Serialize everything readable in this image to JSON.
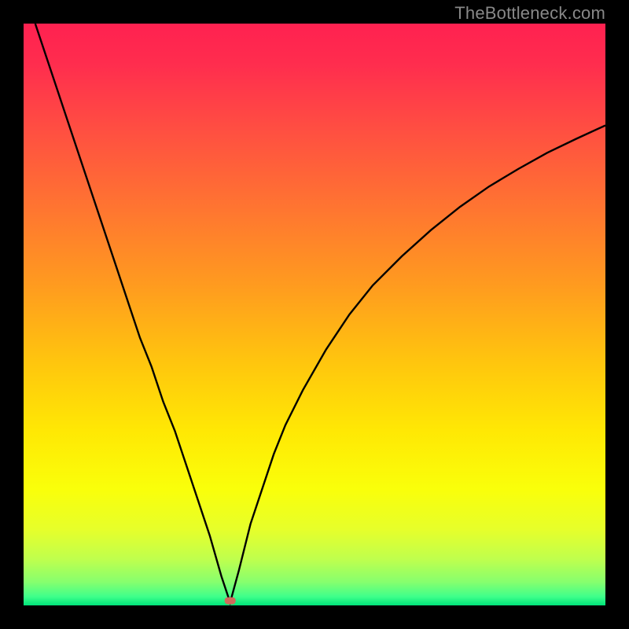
{
  "watermark": "TheBottleneck.com",
  "chart_data": {
    "type": "line",
    "title": "",
    "xlabel": "",
    "ylabel": "",
    "xlim": [
      0,
      100
    ],
    "ylim": [
      0,
      100
    ],
    "background": {
      "type": "vertical_gradient",
      "stops": [
        {
          "pos": 0.0,
          "color": "#ff2150"
        },
        {
          "pos": 0.07,
          "color": "#ff2d4e"
        },
        {
          "pos": 0.17,
          "color": "#ff4b43"
        },
        {
          "pos": 0.3,
          "color": "#ff7033"
        },
        {
          "pos": 0.45,
          "color": "#ff9b1f"
        },
        {
          "pos": 0.58,
          "color": "#ffc50e"
        },
        {
          "pos": 0.7,
          "color": "#ffe804"
        },
        {
          "pos": 0.8,
          "color": "#faff0a"
        },
        {
          "pos": 0.87,
          "color": "#e6ff2b"
        },
        {
          "pos": 0.92,
          "color": "#c0ff4d"
        },
        {
          "pos": 0.96,
          "color": "#86ff6e"
        },
        {
          "pos": 0.985,
          "color": "#3fff8b"
        },
        {
          "pos": 1.0,
          "color": "#00e47a"
        }
      ]
    },
    "marker": {
      "x": 35.5,
      "y": 0.8,
      "color": "#d06a5c"
    },
    "series": [
      {
        "name": "curve",
        "color": "#000000",
        "x": [
          2,
          4,
          6,
          8,
          10,
          12,
          14,
          16,
          18,
          20,
          22,
          24,
          26,
          28,
          30,
          32,
          34,
          35.5,
          37,
          39,
          41,
          43,
          45,
          48,
          52,
          56,
          60,
          65,
          70,
          75,
          80,
          85,
          90,
          95,
          100
        ],
        "y": [
          100,
          94,
          88,
          82,
          76,
          70,
          64,
          58,
          52,
          46,
          41,
          35,
          30,
          24,
          18,
          12,
          5,
          0.5,
          6,
          14,
          20,
          26,
          31,
          37,
          44,
          50,
          55,
          60,
          64.5,
          68.5,
          72,
          75,
          77.8,
          80.2,
          82.5
        ]
      }
    ]
  }
}
